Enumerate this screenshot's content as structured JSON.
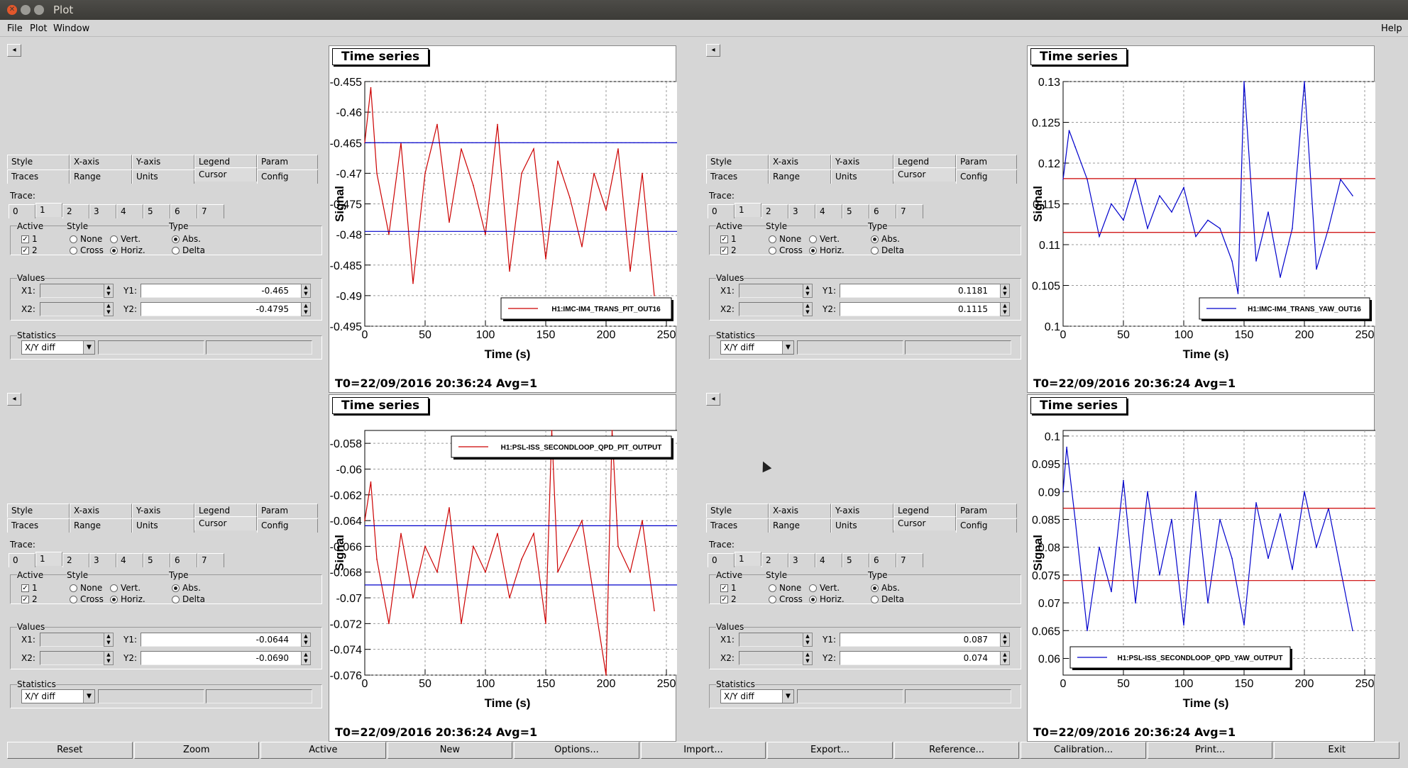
{
  "window": {
    "title": "Plot"
  },
  "menu": {
    "file": "File",
    "plot": "Plot",
    "window": "Window",
    "help": "Help"
  },
  "tabs_row1": [
    "Style",
    "X-axis",
    "Y-axis",
    "Legend",
    "Param"
  ],
  "tabs_row2": [
    "Traces",
    "Range",
    "Units",
    "Cursor",
    "Config"
  ],
  "trace_label": "Trace:",
  "trace_tabs": [
    "0",
    "1",
    "2",
    "3",
    "4",
    "5",
    "6",
    "7"
  ],
  "active_label": "Active",
  "style_label": "Style",
  "type_label": "Type",
  "style_none": "None",
  "style_vert": "Vert.",
  "style_cross": "Cross",
  "style_horiz": "Horiz.",
  "type_abs": "Abs.",
  "type_delta": "Delta",
  "values_label": "Values",
  "x1_label": "X1:",
  "x2_label": "X2:",
  "y1_label": "Y1:",
  "y2_label": "Y2:",
  "statistics_label": "Statistics",
  "stat_combo": "X/Y diff",
  "plot_title": "Time series",
  "xlabel": "Time (s)",
  "ylabel": "Signal",
  "footer": "T0=22/09/2016 20:36:24     Avg=1",
  "panels": [
    {
      "y1": "-0.465",
      "y2": "-0.4795",
      "check1": "1",
      "check2": "2"
    },
    {
      "y1": "0.1181",
      "y2": "0.1115",
      "check1": "1",
      "check2": "2"
    },
    {
      "y1": "-0.0644",
      "y2": "-0.0690",
      "check1": "1",
      "check2": "2"
    },
    {
      "y1": "0.087",
      "y2": "0.074",
      "check1": "1",
      "check2": "2"
    }
  ],
  "chart_data": [
    {
      "type": "line",
      "title": "Time series",
      "xlabel": "Time (s)",
      "ylabel": "Signal",
      "xlim": [
        0,
        260
      ],
      "ylim": [
        -0.495,
        -0.455
      ],
      "yticks": [
        "-0.455",
        "-0.46",
        "-0.465",
        "-0.47",
        "-0.475",
        "-0.48",
        "-0.485",
        "-0.49",
        "-0.495"
      ],
      "xticks": [
        "0",
        "50",
        "100",
        "150",
        "200",
        "250"
      ],
      "series": [
        {
          "name": "H1:IMC-IM4_TRANS_PIT_OUT16",
          "color": "#cc0000",
          "x": [
            0,
            5,
            10,
            20,
            30,
            40,
            50,
            60,
            70,
            80,
            90,
            100,
            110,
            120,
            130,
            140,
            150,
            160,
            170,
            180,
            190,
            200,
            210,
            220,
            230,
            240
          ],
          "y": [
            -0.465,
            -0.456,
            -0.47,
            -0.48,
            -0.465,
            -0.488,
            -0.47,
            -0.462,
            -0.478,
            -0.466,
            -0.472,
            -0.48,
            -0.462,
            -0.486,
            -0.47,
            -0.466,
            -0.484,
            -0.468,
            -0.474,
            -0.482,
            -0.47,
            -0.476,
            -0.466,
            -0.486,
            -0.47,
            -0.49
          ]
        }
      ],
      "cursors": [
        -0.465,
        -0.4795
      ],
      "cursor_color": "#0000cc",
      "legend": "bottom-right"
    },
    {
      "type": "line",
      "title": "Time series",
      "xlabel": "Time (s)",
      "ylabel": "Signal",
      "xlim": [
        0,
        260
      ],
      "ylim": [
        0.1,
        0.13
      ],
      "yticks": [
        "0.13",
        "0.125",
        "0.12",
        "0.115",
        "0.11",
        "0.105",
        "0.1"
      ],
      "xticks": [
        "0",
        "50",
        "100",
        "150",
        "200",
        "250"
      ],
      "series": [
        {
          "name": "H1:IMC-IM4_TRANS_YAW_OUT16",
          "color": "#0000cc",
          "x": [
            0,
            5,
            10,
            20,
            30,
            40,
            50,
            60,
            70,
            80,
            90,
            100,
            110,
            120,
            130,
            140,
            145,
            150,
            160,
            170,
            180,
            190,
            200,
            210,
            220,
            230,
            240
          ],
          "y": [
            0.118,
            0.124,
            0.122,
            0.118,
            0.111,
            0.115,
            0.113,
            0.118,
            0.112,
            0.116,
            0.114,
            0.117,
            0.111,
            0.113,
            0.112,
            0.108,
            0.104,
            0.13,
            0.108,
            0.114,
            0.106,
            0.112,
            0.13,
            0.107,
            0.112,
            0.118,
            0.116
          ]
        }
      ],
      "cursors": [
        0.1181,
        0.1115
      ],
      "cursor_color": "#cc0000",
      "legend": "bottom-right"
    },
    {
      "type": "line",
      "title": "Time series",
      "xlabel": "Time (s)",
      "ylabel": "Signal",
      "xlim": [
        0,
        260
      ],
      "ylim": [
        -0.076,
        -0.057
      ],
      "yticks": [
        "-0.058",
        "-0.06",
        "-0.062",
        "-0.064",
        "-0.066",
        "-0.068",
        "-0.07",
        "-0.072",
        "-0.074",
        "-0.076"
      ],
      "xticks": [
        "0",
        "50",
        "100",
        "150",
        "200",
        "250"
      ],
      "series": [
        {
          "name": "H1:PSL-ISS_SECONDLOOP_QPD_PIT_OUTPUT",
          "color": "#cc0000",
          "x": [
            0,
            5,
            10,
            20,
            30,
            40,
            50,
            60,
            70,
            80,
            90,
            100,
            110,
            120,
            130,
            140,
            150,
            155,
            160,
            170,
            180,
            190,
            200,
            205,
            210,
            220,
            230,
            240
          ],
          "y": [
            -0.064,
            -0.061,
            -0.067,
            -0.072,
            -0.065,
            -0.07,
            -0.066,
            -0.068,
            -0.063,
            -0.072,
            -0.066,
            -0.068,
            -0.065,
            -0.07,
            -0.067,
            -0.065,
            -0.072,
            -0.057,
            -0.068,
            -0.066,
            -0.064,
            -0.07,
            -0.076,
            -0.057,
            -0.066,
            -0.068,
            -0.064,
            -0.071
          ]
        }
      ],
      "cursors": [
        -0.0644,
        -0.069
      ],
      "cursor_color": "#0000cc",
      "legend": "top-right"
    },
    {
      "type": "line",
      "title": "Time series",
      "xlabel": "Time (s)",
      "ylabel": "Signal",
      "xlim": [
        0,
        260
      ],
      "ylim": [
        0.057,
        0.101
      ],
      "yticks": [
        "0.1",
        "0.095",
        "0.09",
        "0.085",
        "0.08",
        "0.075",
        "0.07",
        "0.065",
        "0.06"
      ],
      "xticks": [
        "0",
        "50",
        "100",
        "150",
        "200",
        "250"
      ],
      "series": [
        {
          "name": "H1:PSL-ISS_SECONDLOOP_QPD_YAW_OUTPUT",
          "color": "#0000cc",
          "x": [
            0,
            3,
            10,
            20,
            30,
            40,
            50,
            60,
            70,
            80,
            90,
            100,
            110,
            120,
            130,
            140,
            150,
            160,
            170,
            180,
            190,
            200,
            210,
            220,
            230,
            240
          ],
          "y": [
            0.09,
            0.098,
            0.085,
            0.065,
            0.08,
            0.072,
            0.092,
            0.07,
            0.09,
            0.075,
            0.085,
            0.066,
            0.09,
            0.07,
            0.085,
            0.078,
            0.066,
            0.088,
            0.078,
            0.086,
            0.076,
            0.09,
            0.08,
            0.087,
            0.076,
            0.065
          ]
        }
      ],
      "cursors": [
        0.087,
        0.074
      ],
      "cursor_color": "#cc0000",
      "legend": "bottom-left"
    }
  ],
  "bottom_buttons": [
    "Reset",
    "Zoom",
    "Active",
    "New",
    "Options...",
    "Import...",
    "Export...",
    "Reference...",
    "Calibration...",
    "Print...",
    "Exit"
  ]
}
